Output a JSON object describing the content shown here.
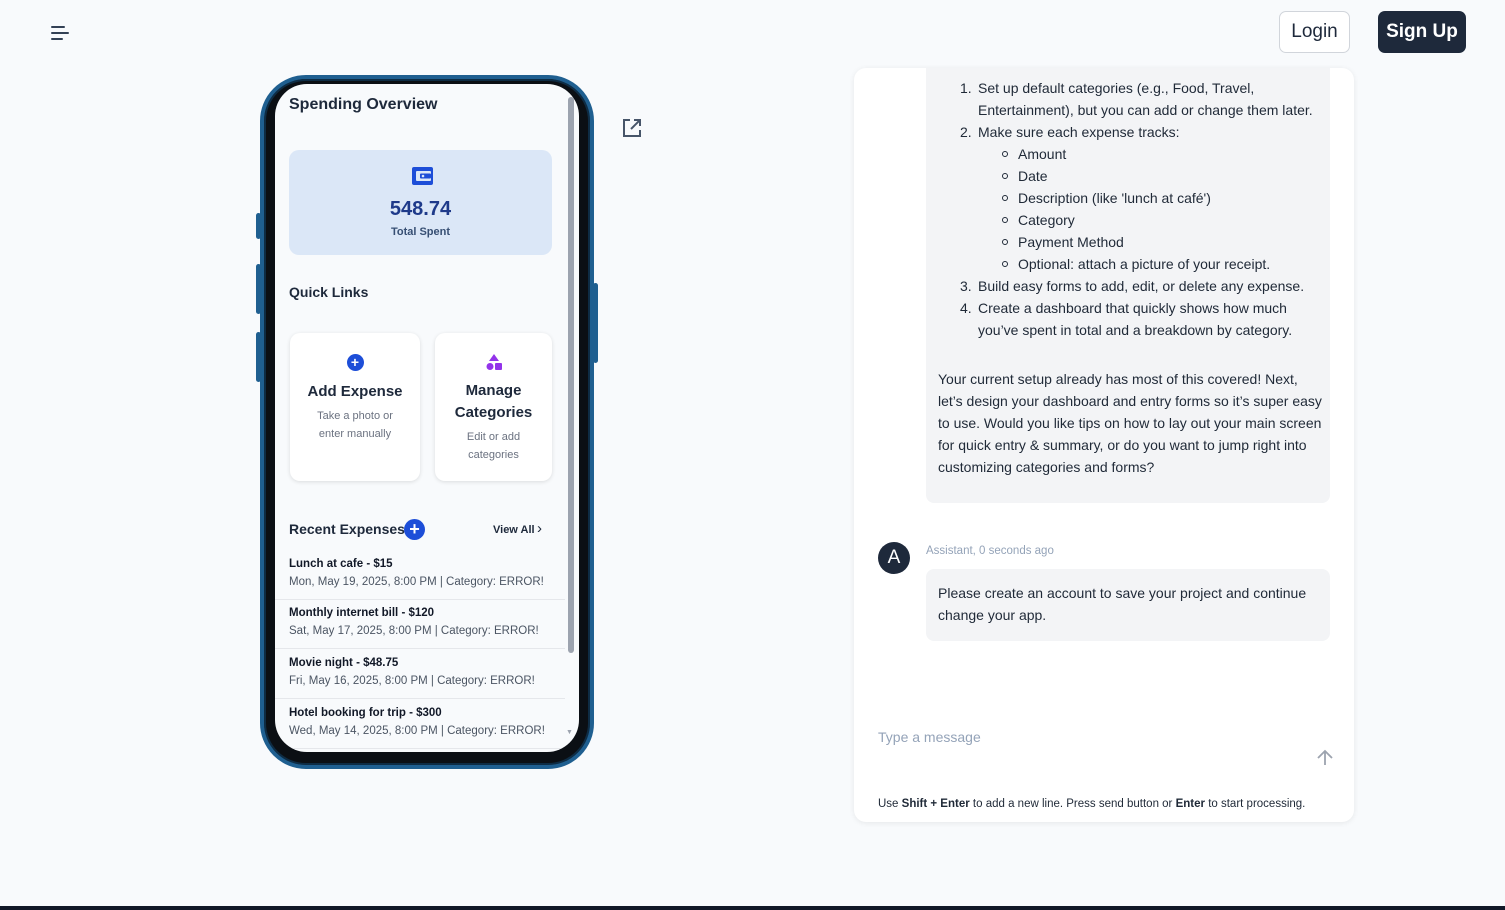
{
  "header": {
    "menu_icon": "hamburger-menu-icon",
    "login_label": "Login",
    "signup_label": "Sign Up"
  },
  "phone": {
    "title": "Spending Overview",
    "total_amount": "548.74",
    "total_label": "Total Spent",
    "quick_links_title": "Quick Links",
    "quick_links": [
      {
        "title": "Add Expense",
        "desc_line1": "Take a photo or",
        "desc_line2": "enter manually",
        "icon": "plus-circle-icon"
      },
      {
        "title_line1": "Manage",
        "title_line2": "Categories",
        "desc_line1": "Edit or add",
        "desc_line2": "categories",
        "icon": "shapes-icon"
      }
    ],
    "recent_title": "Recent Expenses",
    "view_all": "View All",
    "expenses": [
      {
        "title": "Lunch at cafe - $15",
        "sub": "Mon, May 19, 2025, 8:00 PM | Category: ERROR!"
      },
      {
        "title": "Monthly internet bill - $120",
        "sub": "Sat, May 17, 2025, 8:00 PM | Category: ERROR!"
      },
      {
        "title": "Movie night - $48.75",
        "sub": "Fri, May 16, 2025, 8:00 PM | Category: ERROR!"
      },
      {
        "title": "Hotel booking for trip - $300",
        "sub": "Wed, May 14, 2025, 8:00 PM | Category: ERROR!"
      }
    ],
    "colors": {
      "accent": "#1d4ed8",
      "frame": "#1f5f90",
      "card": "#dbe7f7",
      "category_icon": "#9333ea"
    }
  },
  "chat": {
    "list": [
      {
        "num": "1.",
        "line1": "Set up default categories (e.g., Food, Travel,",
        "line2": "Entertainment), but you can add or change them later."
      },
      {
        "num": "2.",
        "line1": "Make sure each expense tracks:"
      },
      {
        "num": "3.",
        "line1": "Build easy forms to add, edit, or delete any expense."
      },
      {
        "num": "4.",
        "line1": "Create a dashboard that quickly shows how much",
        "line2": "you’ve spent in total and a breakdown by category."
      }
    ],
    "tracks": [
      "Amount",
      "Date",
      "Description (like 'lunch at café')",
      "Category",
      "Payment Method",
      "Optional: attach a picture of your receipt."
    ],
    "paragraph": "Your current setup already has most of this covered! Next, let’s design your dashboard and entry forms so it’s super easy to use. Would you like tips on how to lay out your main screen for quick entry & summary, or do you want to jump right into customizing categories and forms?",
    "avatar_letter": "A",
    "assistant_meta": "Assistant,  0 seconds ago",
    "assistant_message": "Please create an account to save your project and continue change your app.",
    "input_placeholder": "Type a message",
    "hint": {
      "use": "Use",
      "shift_enter": "Shift + Enter",
      "mid": "to add a new line. Press send button or",
      "enter": "Enter",
      "end": "to start processing."
    }
  }
}
